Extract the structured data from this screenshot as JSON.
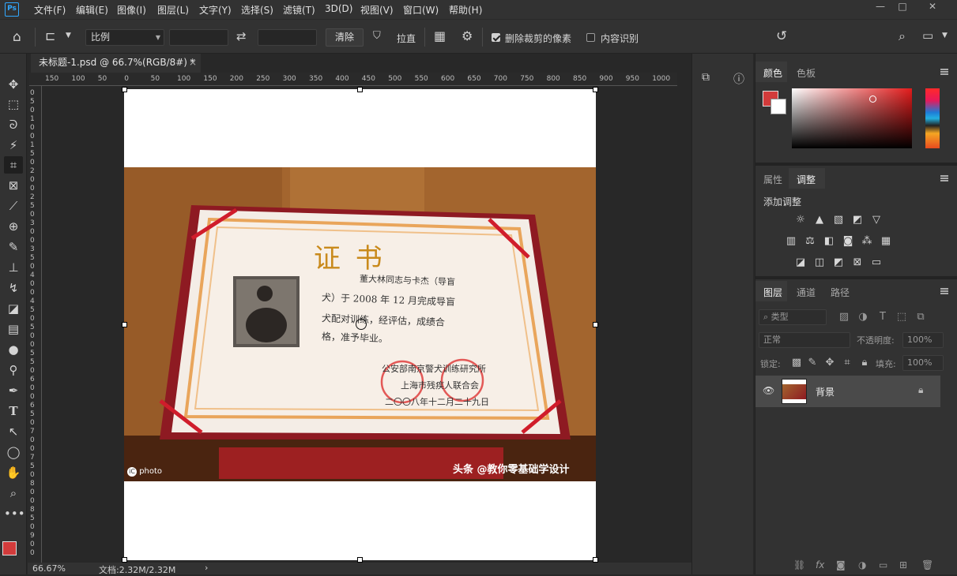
{
  "app": {
    "logo": "Ps",
    "menu": [
      "文件(F)",
      "编辑(E)",
      "图像(I)",
      "图层(L)",
      "文字(Y)",
      "选择(S)",
      "滤镜(T)",
      "3D(D)",
      "视图(V)",
      "窗口(W)",
      "帮助(H)"
    ],
    "window_controls": [
      "—",
      "□",
      "✕"
    ]
  },
  "options": {
    "ratio_select": "比例",
    "width_value": "",
    "height_value": "",
    "clear_button": "清除",
    "straighten_label": "拉直",
    "delete_cropped_label": "删除裁剪的像素",
    "delete_cropped_checked": true,
    "content_aware_label": "内容识别",
    "content_aware_checked": false
  },
  "document": {
    "tab_title": "未标题-1.psd @ 66.7%(RGB/8#) *",
    "close_glyph": "×"
  },
  "rulers": {
    "horizontal": [
      "150",
      "100",
      "50",
      "0",
      "50",
      "100",
      "150",
      "200",
      "250",
      "300",
      "350",
      "400",
      "450",
      "500",
      "550",
      "600",
      "650",
      "700",
      "750",
      "800",
      "850",
      "900",
      "950",
      "1000"
    ],
    "vertical": [
      "0",
      "5",
      "0",
      "1",
      "0",
      "0",
      "1",
      "5",
      "0",
      "2",
      "0",
      "0",
      "2",
      "5",
      "0",
      "3",
      "0",
      "0",
      "3",
      "5",
      "0",
      "4",
      "0",
      "0",
      "4",
      "5",
      "0",
      "5",
      "0",
      "0",
      "5",
      "5",
      "0",
      "6",
      "0",
      "0",
      "6",
      "5",
      "0",
      "7",
      "0",
      "0",
      "7",
      "5",
      "0",
      "8",
      "0",
      "0",
      "8",
      "5",
      "0",
      "9",
      "0",
      "0"
    ]
  },
  "certificate": {
    "title": "证   书",
    "line1": "董大林同志与卡杰（导盲",
    "line2": "犬）于 2008 年 12 月完成导盲",
    "line3": "犬配对训练，经评估，成绩合",
    "line4": "格，准予毕业。",
    "issuer1": "公安部南京警犬训练研究所",
    "issuer2": "上海市残疾人联合会",
    "date": "二〇〇八年十二月二十九日",
    "watermark_left": "photo",
    "watermark_right": "头条 @教你零基础学设计"
  },
  "status": {
    "zoom": "66.67%",
    "doc_size": "文档:2.32M/2.32M"
  },
  "color_panel": {
    "tabs": [
      "颜色",
      "色板"
    ],
    "foreground": "#d23b3b",
    "background": "#ffffff"
  },
  "adjust_panel": {
    "tabs": [
      "属性",
      "调整"
    ],
    "add_label": "添加调整"
  },
  "layers_panel": {
    "tabs": [
      "图层",
      "通道",
      "路径"
    ],
    "kind_filter": "类型",
    "blend_mode": "正常",
    "opacity_label": "不透明度:",
    "opacity_value": "100%",
    "lock_label": "锁定:",
    "fill_label": "填充:",
    "fill_value": "100%",
    "layers": [
      {
        "name": "背景",
        "visible": true,
        "locked": true
      }
    ]
  }
}
